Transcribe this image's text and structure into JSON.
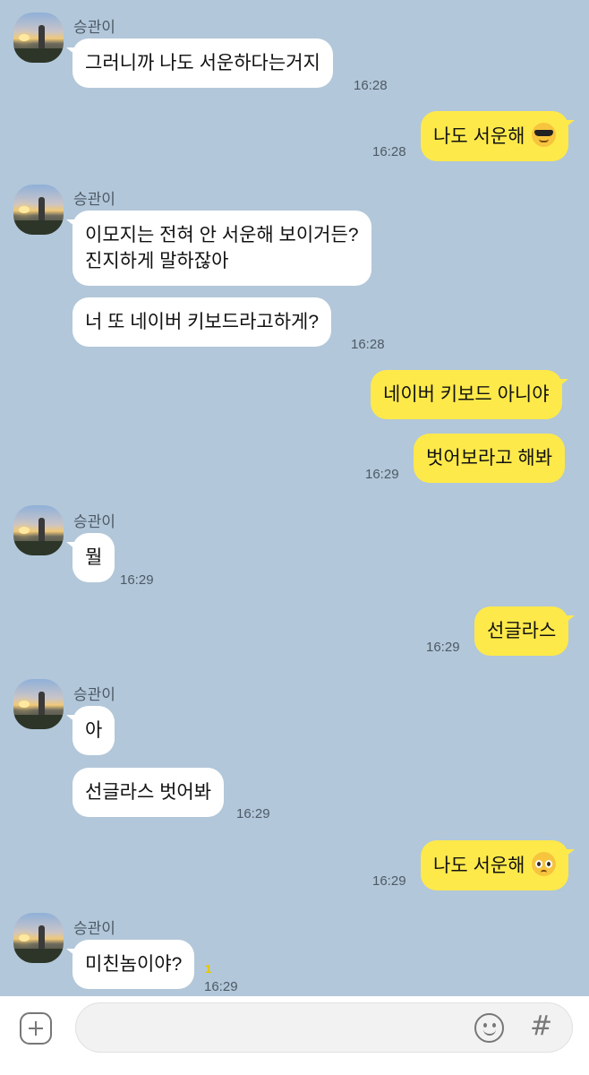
{
  "chat": {
    "sender_name": "승관이",
    "messages": [
      {
        "text": "그러니까 나도 서운하다는거지",
        "time": "16:28"
      },
      {
        "text": "나도 서운해",
        "emoji": "smiling-face-with-sunglasses",
        "time": "16:28"
      },
      {
        "line1": "이모지는 전혀 안 서운해 보이거든?",
        "line2": "진지하게 말하잖아"
      },
      {
        "text": "너 또 네이버 키보드라고하게?",
        "time": "16:28"
      },
      {
        "text": "네이버 키보드 아니야"
      },
      {
        "text": "벗어보라고 해봐",
        "time": "16:29"
      },
      {
        "text": "뭘",
        "time": "16:29"
      },
      {
        "text": "선글라스",
        "time": "16:29"
      },
      {
        "text": "아"
      },
      {
        "text": "선글라스 벗어봐",
        "time": "16:29"
      },
      {
        "text": "나도 서운해",
        "emoji": "pleading-face",
        "time": "16:29"
      },
      {
        "text": "미친놈이야?",
        "time": "16:29",
        "unread": "1"
      }
    ]
  },
  "input_bar": {
    "placeholder": "",
    "icons": [
      "plus-icon",
      "emoji-icon",
      "hash-icon"
    ],
    "hash_glyph": "#"
  },
  "colors": {
    "background": "#b2c7d9",
    "incoming_bubble": "#ffffff",
    "outgoing_bubble": "#fee94a",
    "unread": "#e6c600"
  }
}
